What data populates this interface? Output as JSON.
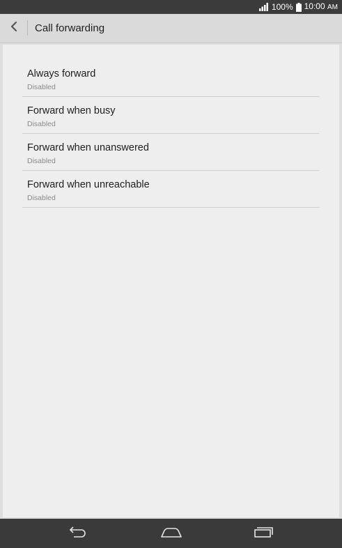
{
  "status_bar": {
    "battery": "100%",
    "time": "10:00",
    "ampm": "AM"
  },
  "header": {
    "title": "Call forwarding"
  },
  "settings": {
    "items": [
      {
        "title": "Always forward",
        "summary": "Disabled"
      },
      {
        "title": "Forward when busy",
        "summary": "Disabled"
      },
      {
        "title": "Forward when unanswered",
        "summary": "Disabled"
      },
      {
        "title": "Forward when unreachable",
        "summary": "Disabled"
      }
    ]
  },
  "icons": {
    "back": "back-chevron-icon",
    "signal": "signal-icon",
    "battery": "battery-icon",
    "nav_back": "nav-back-icon",
    "nav_home": "nav-home-icon",
    "nav_recents": "nav-recents-icon"
  }
}
